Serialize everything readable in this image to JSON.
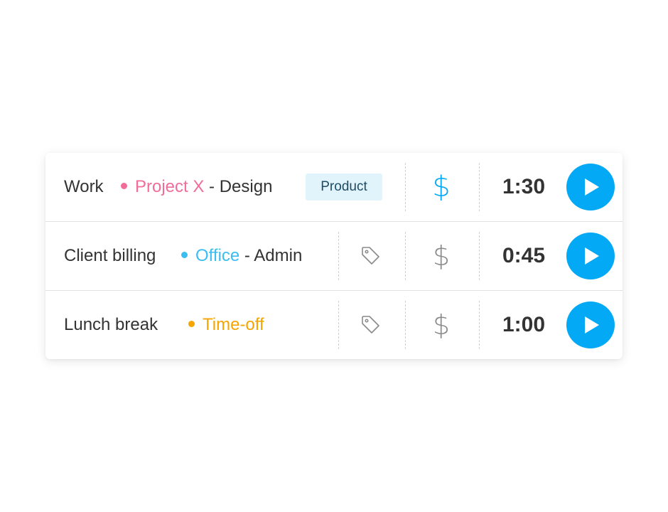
{
  "entries": [
    {
      "description": "Work",
      "project": "Project X",
      "task": "- Design",
      "project_color": "#f06d9b",
      "tag": "Product",
      "billable": true,
      "billable_icon": "dollar-icon",
      "duration": "1:30",
      "action_icon": "play-icon"
    },
    {
      "description": "Client billing",
      "project": "Office",
      "task": "- Admin",
      "project_color": "#3bbdf2",
      "tag_icon": "tag-icon",
      "billable": false,
      "billable_icon": "dollar-icon",
      "duration": "0:45",
      "action_icon": "play-icon"
    },
    {
      "description": "Lunch break",
      "project": "Time-off",
      "task": "",
      "project_color": "#f5a500",
      "tag_icon": "tag-icon",
      "billable": false,
      "billable_icon": "dollar-icon",
      "duration": "1:00",
      "action_icon": "play-icon"
    }
  ],
  "dollar_symbol": "$",
  "colors": {
    "accent": "#03a9f4",
    "tag_badge_bg": "#e1f3fb",
    "tag_badge_text": "#1d4c66",
    "text": "#333333",
    "icon_inactive": "#8a8a8a"
  }
}
